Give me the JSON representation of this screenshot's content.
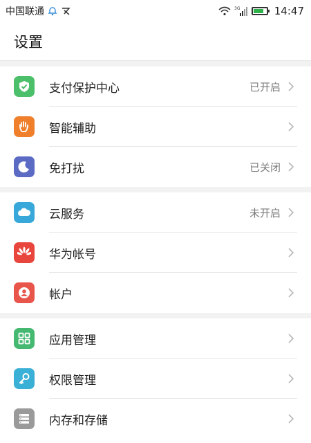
{
  "statusbar": {
    "carrier": "中国联通",
    "time": "14:47",
    "network_tag": "3G"
  },
  "header": {
    "title": "设置"
  },
  "groups": [
    {
      "items": [
        {
          "label": "支付保护中心",
          "status": "已开启",
          "icon": "shield-check-icon",
          "color": "#4cbf6a"
        },
        {
          "label": "智能辅助",
          "status": "",
          "icon": "hand-icon",
          "color": "#f07f2b"
        },
        {
          "label": "免打扰",
          "status": "已关闭",
          "icon": "moon-icon",
          "color": "#5b6bc4"
        }
      ]
    },
    {
      "items": [
        {
          "label": "云服务",
          "status": "未开启",
          "icon": "cloud-icon",
          "color": "#37a8d9"
        },
        {
          "label": "华为帐号",
          "status": "",
          "icon": "huawei-icon",
          "color": "#e8463c"
        },
        {
          "label": "帐户",
          "status": "",
          "icon": "user-icon",
          "color": "#e8554a"
        }
      ]
    },
    {
      "items": [
        {
          "label": "应用管理",
          "status": "",
          "icon": "grid-icon",
          "color": "#45b872"
        },
        {
          "label": "权限管理",
          "status": "",
          "icon": "key-icon",
          "color": "#3ab0d6"
        },
        {
          "label": "内存和存储",
          "status": "",
          "icon": "storage-icon",
          "color": "#9a9a9a"
        }
      ]
    }
  ]
}
